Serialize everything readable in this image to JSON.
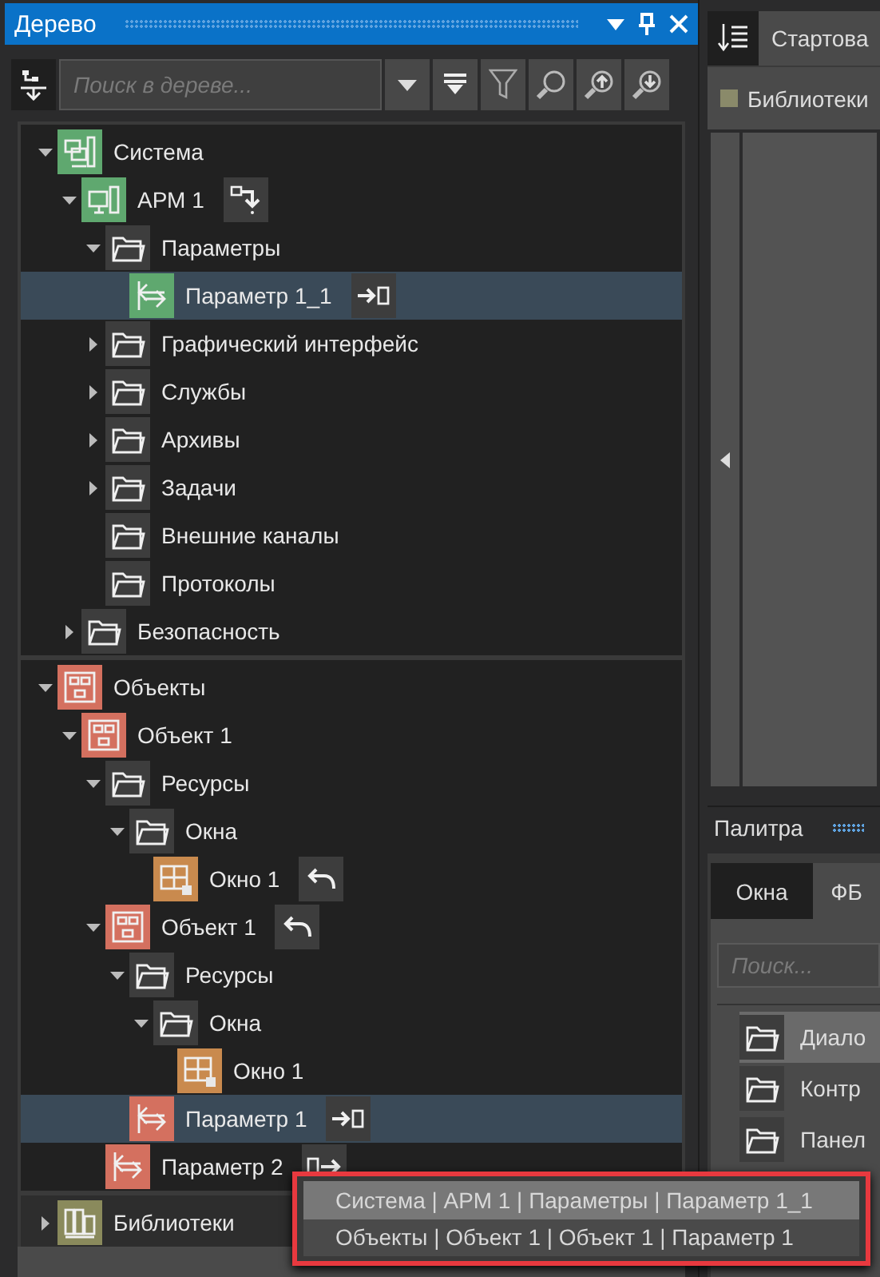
{
  "tree_panel": {
    "title": "Дерево",
    "search": {
      "placeholder": "Поиск в дереве..."
    },
    "tree_sections": [
      {
        "nodes": [
          {
            "label": "Система",
            "kind": "system",
            "expanded": true,
            "selected": false,
            "children": [
              {
                "label": "АРМ 1",
                "kind": "workstation",
                "expanded": true,
                "selected": false,
                "action": {
                  "kind": "reorder"
                },
                "children": [
                  {
                    "label": "Параметры",
                    "kind": "folder",
                    "expanded": true,
                    "selected": false,
                    "children": [
                      {
                        "label": "Параметр 1_1",
                        "kind": "param-green",
                        "selected": true,
                        "action": {
                          "kind": "link-in"
                        }
                      }
                    ]
                  },
                  {
                    "label": "Графический интерфейс",
                    "kind": "folder",
                    "expanded": false,
                    "selected": false
                  },
                  {
                    "label": "Службы",
                    "kind": "folder",
                    "expanded": false,
                    "selected": false
                  },
                  {
                    "label": "Архивы",
                    "kind": "folder",
                    "expanded": false,
                    "selected": false
                  },
                  {
                    "label": "Задачи",
                    "kind": "folder",
                    "expanded": false,
                    "selected": false
                  },
                  {
                    "label": "Внешние каналы",
                    "kind": "folder",
                    "selected": false
                  },
                  {
                    "label": "Протоколы",
                    "kind": "folder",
                    "selected": false
                  }
                ]
              },
              {
                "label": "Безопасность",
                "kind": "folder",
                "expanded": false,
                "selected": false
              }
            ]
          }
        ]
      },
      {
        "nodes": [
          {
            "label": "Объекты",
            "kind": "objects",
            "expanded": true,
            "selected": false,
            "children": [
              {
                "label": "Объект 1",
                "kind": "object",
                "expanded": true,
                "selected": false,
                "children": [
                  {
                    "label": "Ресурсы",
                    "kind": "folder",
                    "expanded": true,
                    "selected": false,
                    "children": [
                      {
                        "label": "Окна",
                        "kind": "folder",
                        "expanded": true,
                        "selected": false,
                        "children": [
                          {
                            "label": "Окно 1",
                            "kind": "window",
                            "selected": false,
                            "action": {
                              "kind": "undo"
                            }
                          }
                        ]
                      }
                    ]
                  },
                  {
                    "label": "Объект 1",
                    "kind": "object",
                    "expanded": true,
                    "selected": false,
                    "action": {
                      "kind": "undo"
                    },
                    "children": [
                      {
                        "label": "Ресурсы",
                        "kind": "folder",
                        "expanded": true,
                        "selected": false,
                        "children": [
                          {
                            "label": "Окна",
                            "kind": "folder",
                            "expanded": true,
                            "selected": false,
                            "children": [
                              {
                                "label": "Окно 1",
                                "kind": "window",
                                "selected": false
                              }
                            ]
                          }
                        ]
                      },
                      {
                        "label": "Параметр 1",
                        "kind": "param-red",
                        "selected": true,
                        "action": {
                          "kind": "link-in"
                        }
                      }
                    ]
                  },
                  {
                    "label": "Параметр 2",
                    "kind": "param-red",
                    "selected": false,
                    "action": {
                      "kind": "link-out"
                    }
                  }
                ]
              }
            ]
          }
        ]
      },
      {
        "nodes": [
          {
            "label": "Библиотеки",
            "kind": "library",
            "expanded": false,
            "selected": false
          }
        ]
      }
    ]
  },
  "document": {
    "tab": "Стартова",
    "toolbar_label": "Библиотеки"
  },
  "palette": {
    "title": "Палитра",
    "tabs": [
      {
        "label": "Окна",
        "selected": true
      },
      {
        "label": "ФБ",
        "selected": false
      }
    ],
    "search": {
      "placeholder": "Поиск..."
    },
    "items": [
      {
        "label": "Диало",
        "selected": true
      },
      {
        "label": "Контр",
        "selected": false
      },
      {
        "label": "Панел",
        "selected": false
      }
    ]
  },
  "popup": {
    "items": [
      {
        "label": "Система | АРМ 1 | Параметры | Параметр 1_1",
        "selected": true
      },
      {
        "label": "Объекты | Объект 1 | Объект 1 | Параметр 1",
        "selected": false
      }
    ]
  }
}
